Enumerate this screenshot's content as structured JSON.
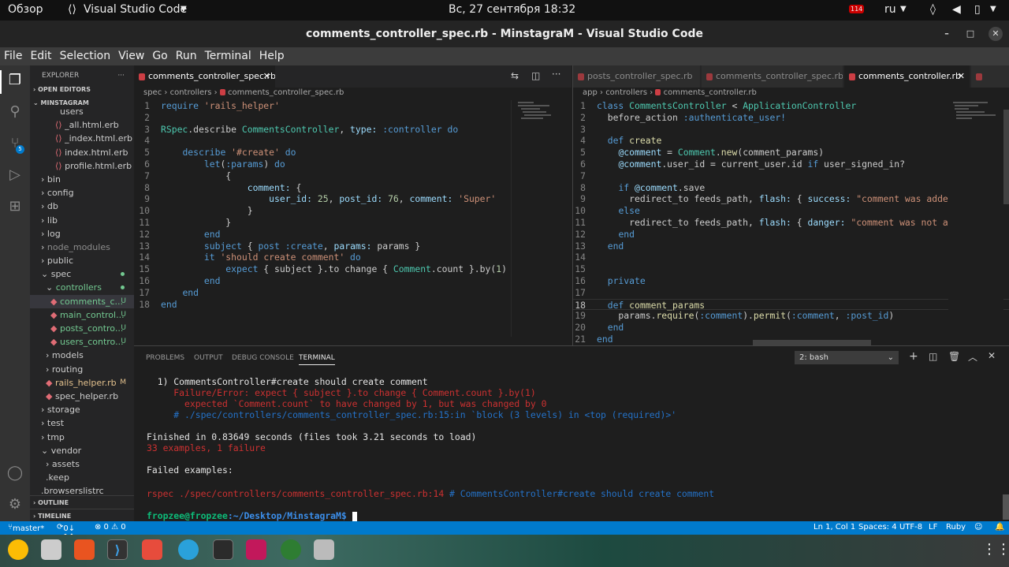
{
  "topbar": {
    "overview": "Обзор",
    "app": "Visual Studio Code",
    "clock": "Вс, 27 сентября  18:32",
    "lang": "ru",
    "badge": "114"
  },
  "window": {
    "title": "comments_controller_spec.rb - MinstagraM - Visual Studio Code"
  },
  "menu": [
    "File",
    "Edit",
    "Selection",
    "View",
    "Go",
    "Run",
    "Terminal",
    "Help"
  ],
  "activity_badge": "5",
  "sidebar": {
    "title": "EXPLORER",
    "open_editors": "OPEN EDITORS",
    "project": "MINSTAGRAM",
    "outline": "OUTLINE",
    "timeline": "TIMELINE",
    "tree": [
      {
        "label": "users",
        "indent": 38,
        "kind": "fold"
      },
      {
        "label": "_all.html.erb",
        "indent": 32,
        "kind": "erb"
      },
      {
        "label": "_index.html.erb",
        "indent": 32,
        "kind": "erb"
      },
      {
        "label": "index.html.erb",
        "indent": 32,
        "kind": "erb"
      },
      {
        "label": "profile.html.erb",
        "indent": 32,
        "kind": "erb"
      },
      {
        "label": "bin",
        "indent": 14,
        "kind": "dir"
      },
      {
        "label": "config",
        "indent": 14,
        "kind": "dir"
      },
      {
        "label": "db",
        "indent": 14,
        "kind": "dir"
      },
      {
        "label": "lib",
        "indent": 14,
        "kind": "dir"
      },
      {
        "label": "log",
        "indent": 14,
        "kind": "dir"
      },
      {
        "label": "node_modules",
        "indent": 14,
        "kind": "dirdim"
      },
      {
        "label": "public",
        "indent": 14,
        "kind": "dir"
      },
      {
        "label": "spec",
        "indent": 14,
        "kind": "open",
        "dot": true
      },
      {
        "label": "controllers",
        "indent": 20,
        "kind": "open",
        "dot": true,
        "green": true
      },
      {
        "label": "comments_c...",
        "indent": 26,
        "kind": "rb",
        "badge": "U",
        "green": true,
        "sel": true
      },
      {
        "label": "main_control...",
        "indent": 26,
        "kind": "rb",
        "badge": "U",
        "green": true
      },
      {
        "label": "posts_contro...",
        "indent": 26,
        "kind": "rb",
        "badge": "U",
        "green": true
      },
      {
        "label": "users_contro...",
        "indent": 26,
        "kind": "rb",
        "badge": "U",
        "green": true
      },
      {
        "label": "models",
        "indent": 20,
        "kind": "dir"
      },
      {
        "label": "routing",
        "indent": 20,
        "kind": "dir"
      },
      {
        "label": "rails_helper.rb",
        "indent": 20,
        "kind": "rb",
        "badge": "M",
        "mod": true
      },
      {
        "label": "spec_helper.rb",
        "indent": 20,
        "kind": "rb"
      },
      {
        "label": "storage",
        "indent": 14,
        "kind": "dir"
      },
      {
        "label": "test",
        "indent": 14,
        "kind": "dir"
      },
      {
        "label": "tmp",
        "indent": 14,
        "kind": "dir"
      },
      {
        "label": "vendor",
        "indent": 14,
        "kind": "open"
      },
      {
        "label": "assets",
        "indent": 20,
        "kind": "dir"
      },
      {
        "label": ".keep",
        "indent": 20,
        "kind": "file"
      },
      {
        "label": ".browserslistrc",
        "indent": 14,
        "kind": "file"
      }
    ]
  },
  "left_editor": {
    "tab": "comments_controller_spec.rb",
    "crumb": [
      "spec",
      "controllers",
      "comments_controller_spec.rb"
    ]
  },
  "right_editor": {
    "tabs": [
      "posts_controller_spec.rb",
      "comments_controller_spec.rb",
      "comments_controller.rb"
    ],
    "crumb": [
      "app",
      "controllers",
      "comments_controller.rb"
    ]
  },
  "panel": {
    "tabs": [
      "PROBLEMS",
      "OUTPUT",
      "DEBUG CONSOLE",
      "TERMINAL"
    ],
    "shell": "2: bash",
    "terminal": [
      {
        "t": "  1) CommentsController#create should create comment",
        "c": "tw"
      },
      {
        "t": "     Failure/Error: expect { subject }.to change { Comment.count }.by(1)",
        "c": "tr"
      },
      {
        "t": "       expected `Comment.count` to have changed by 1, but was changed by 0",
        "c": "tr"
      },
      {
        "t": "     # ./spec/controllers/comments_controller_spec.rb:15:in `block (3 levels) in <top (required)>'",
        "c": "tc"
      },
      {
        "t": "",
        "c": "tw"
      },
      {
        "t": "Finished in 0.83649 seconds (files took 3.21 seconds to load)",
        "c": "tw"
      },
      {
        "t": "33 examples, 1 failure",
        "c": "tr"
      },
      {
        "t": "",
        "c": "tw"
      },
      {
        "t": "Failed examples:",
        "c": "tw"
      },
      {
        "t": "",
        "c": "tw"
      }
    ],
    "rspec_cmd": "rspec ./spec/controllers/comments_controller_spec.rb:14",
    "rspec_comment": " # CommentsController#create should create comment",
    "prompt_user": "fropzee@fropzee",
    "prompt_path": ":~/Desktop/MinstagraM$"
  },
  "status": {
    "branch": "master*",
    "sync": "0↓ 1↑",
    "problems": "⊗ 0 ⚠ 0",
    "pos": "Ln 1, Col 1",
    "spaces": "Spaces: 4",
    "enc": "UTF-8",
    "eol": "LF",
    "lang": "Ruby"
  }
}
